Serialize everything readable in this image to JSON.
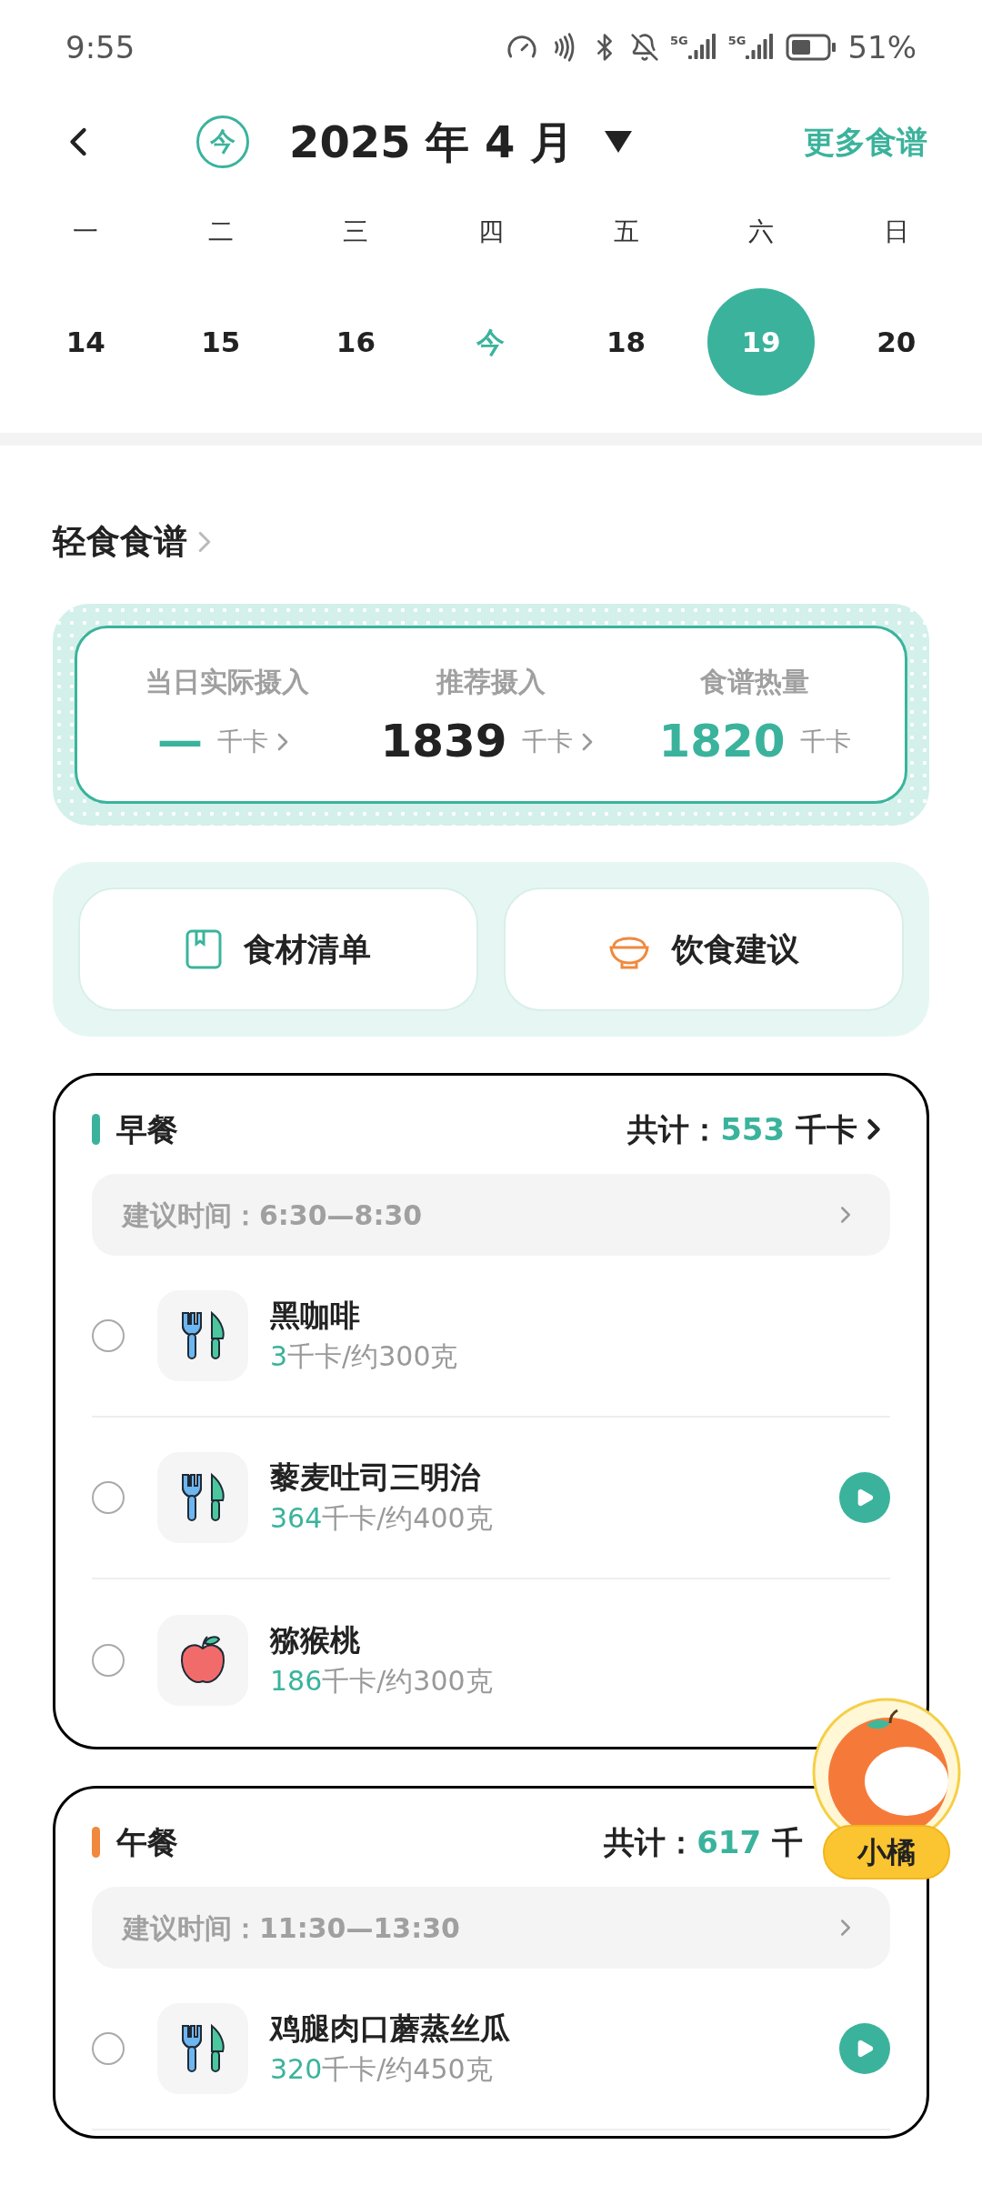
{
  "status_bar": {
    "time": "9:55",
    "signals": [
      "5G",
      "5G"
    ],
    "battery": "51%"
  },
  "header": {
    "today_badge": "今",
    "title": "2025 年 4 月",
    "more": "更多食谱"
  },
  "week": {
    "weekdays": [
      "一",
      "二",
      "三",
      "四",
      "五",
      "六",
      "日"
    ],
    "dates": [
      {
        "label": "14",
        "kind": "date",
        "selected": false
      },
      {
        "label": "15",
        "kind": "date",
        "selected": false
      },
      {
        "label": "16",
        "kind": "date",
        "selected": false
      },
      {
        "label": "今",
        "kind": "today",
        "selected": false
      },
      {
        "label": "18",
        "kind": "date",
        "selected": false
      },
      {
        "label": "19",
        "kind": "date",
        "selected": true
      },
      {
        "label": "20",
        "kind": "date",
        "selected": false
      }
    ]
  },
  "section_title": "轻食食谱",
  "summary": [
    {
      "label": "当日实际摄入",
      "value": "—",
      "unit": "千卡",
      "highlight": true,
      "has_chevron": true
    },
    {
      "label": "推荐摄入",
      "value": "1839",
      "unit": "千卡",
      "highlight": false,
      "has_chevron": true
    },
    {
      "label": "食谱热量",
      "value": "1820",
      "unit": "千卡",
      "highlight": true,
      "has_chevron": false
    }
  ],
  "actions": [
    {
      "label": "食材清单",
      "kind": "list"
    },
    {
      "label": "饮食建议",
      "kind": "bowl"
    }
  ],
  "meals": [
    {
      "title": "早餐",
      "color": "#3bb39c",
      "total_label": "共计：",
      "total": "553",
      "total_unit": "千卡",
      "has_chevron": true,
      "time": "建议时间：6:30—8:30",
      "foods": [
        {
          "name": "黑咖啡",
          "kcal": "3",
          "detail": "千卡/约300克",
          "kind": "utensils",
          "checked": false,
          "video": false
        },
        {
          "name": "藜麦吐司三明治",
          "kcal": "364",
          "detail": "千卡/约400克",
          "kind": "utensils",
          "checked": false,
          "video": true
        },
        {
          "name": "猕猴桃",
          "kcal": "186",
          "detail": "千卡/约300克",
          "kind": "fruit",
          "checked": false,
          "video": false
        }
      ]
    },
    {
      "title": "午餐",
      "color": "#f0883e",
      "total_label": "共计：",
      "total": "617",
      "total_unit": "千",
      "has_chevron": false,
      "time": "建议时间：11:30—13:30",
      "foods": [
        {
          "name": "鸡腿肉口蘑蒸丝瓜",
          "kcal": "320",
          "detail": "千卡/约450克",
          "kind": "utensils",
          "checked": false,
          "video": true
        }
      ]
    }
  ],
  "assistant": {
    "label": "小橘"
  }
}
